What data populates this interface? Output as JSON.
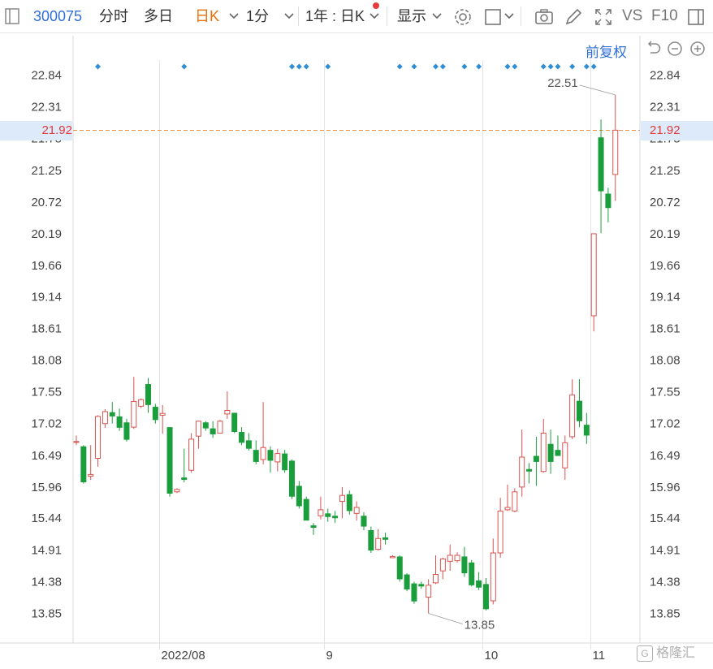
{
  "toolbar": {
    "code": "300075",
    "tab_fenshi": "分时",
    "tab_duori": "多日",
    "tab_rik": "日K",
    "tab_1fen": "1分",
    "range": "1年 : 日K",
    "display": "显示",
    "vs": "VS",
    "f10": "F10",
    "accent_color": "#e8710a",
    "code_color": "#2f6fd6"
  },
  "subbar": {
    "adjust_label": "前复权"
  },
  "current_price": {
    "left": "21.92",
    "right": "21.92",
    "value": 21.92
  },
  "annotations": {
    "high_label": "22.51",
    "low_label": "13.85"
  },
  "watermark": {
    "text": "格隆汇"
  },
  "chart_data": {
    "type": "candlestick",
    "y_ticks": [
      "22.84",
      "22.31",
      "21.78",
      "21.25",
      "20.72",
      "20.19",
      "19.66",
      "19.14",
      "18.61",
      "18.08",
      "17.55",
      "17.02",
      "16.49",
      "15.96",
      "15.44",
      "14.91",
      "14.38",
      "13.85"
    ],
    "ylim": [
      13.85,
      22.84
    ],
    "x_labels": [
      {
        "label": "2022/08",
        "index": 12
      },
      {
        "label": "9",
        "index": 35
      },
      {
        "label": "10",
        "index": 57
      },
      {
        "label": "11",
        "index": 72
      }
    ],
    "up_color": "#d9534f",
    "down_color": "#1a9e3c",
    "marker_color": "#2f8fd6",
    "markers": [
      3,
      15,
      30,
      31,
      32,
      35,
      45,
      47,
      50,
      51,
      54,
      56,
      60,
      61,
      65,
      66,
      67,
      69,
      71,
      72
    ],
    "candles": [
      {
        "o": 16.72,
        "h": 16.82,
        "l": 16.66,
        "c": 16.72
      },
      {
        "o": 16.64,
        "h": 16.66,
        "l": 16.02,
        "c": 16.04
      },
      {
        "o": 16.14,
        "h": 16.66,
        "l": 16.08,
        "c": 16.17
      },
      {
        "o": 16.44,
        "h": 17.16,
        "l": 16.3,
        "c": 17.14
      },
      {
        "o": 17.02,
        "h": 17.26,
        "l": 16.95,
        "c": 17.22
      },
      {
        "o": 17.21,
        "h": 17.38,
        "l": 17.02,
        "c": 17.14
      },
      {
        "o": 17.14,
        "h": 17.27,
        "l": 16.9,
        "c": 16.95
      },
      {
        "o": 17.04,
        "h": 17.1,
        "l": 16.72,
        "c": 16.75
      },
      {
        "o": 16.96,
        "h": 17.8,
        "l": 16.93,
        "c": 17.39
      },
      {
        "o": 17.31,
        "h": 17.44,
        "l": 17.28,
        "c": 17.42
      },
      {
        "o": 17.68,
        "h": 17.78,
        "l": 17.2,
        "c": 17.33
      },
      {
        "o": 17.3,
        "h": 17.35,
        "l": 17.02,
        "c": 17.08
      },
      {
        "o": 17.16,
        "h": 17.33,
        "l": 16.85,
        "c": 17.19
      },
      {
        "o": 16.96,
        "h": 16.96,
        "l": 15.8,
        "c": 15.85
      },
      {
        "o": 15.88,
        "h": 15.94,
        "l": 15.86,
        "c": 15.92
      },
      {
        "o": 16.12,
        "h": 16.6,
        "l": 16.04,
        "c": 16.08
      },
      {
        "o": 16.24,
        "h": 16.86,
        "l": 16.2,
        "c": 16.76
      },
      {
        "o": 16.81,
        "h": 17.06,
        "l": 16.6,
        "c": 17.06
      },
      {
        "o": 17.04,
        "h": 17.06,
        "l": 16.9,
        "c": 16.94
      },
      {
        "o": 16.94,
        "h": 17.06,
        "l": 16.78,
        "c": 16.84
      },
      {
        "o": 16.86,
        "h": 17.08,
        "l": 16.86,
        "c": 17.06
      },
      {
        "o": 17.18,
        "h": 17.56,
        "l": 17.1,
        "c": 17.24
      },
      {
        "o": 17.2,
        "h": 17.2,
        "l": 16.86,
        "c": 16.88
      },
      {
        "o": 16.88,
        "h": 16.96,
        "l": 16.66,
        "c": 16.7
      },
      {
        "o": 16.74,
        "h": 16.86,
        "l": 16.57,
        "c": 16.6
      },
      {
        "o": 16.58,
        "h": 16.74,
        "l": 16.34,
        "c": 16.38
      },
      {
        "o": 16.42,
        "h": 17.38,
        "l": 16.34,
        "c": 16.62
      },
      {
        "o": 16.58,
        "h": 16.64,
        "l": 16.2,
        "c": 16.4
      },
      {
        "o": 16.38,
        "h": 16.6,
        "l": 16.22,
        "c": 16.52
      },
      {
        "o": 16.52,
        "h": 16.58,
        "l": 16.2,
        "c": 16.24
      },
      {
        "o": 16.4,
        "h": 16.42,
        "l": 15.76,
        "c": 15.8
      },
      {
        "o": 15.98,
        "h": 16.06,
        "l": 15.6,
        "c": 15.64
      },
      {
        "o": 15.76,
        "h": 15.8,
        "l": 15.44,
        "c": 15.4
      },
      {
        "o": 15.32,
        "h": 15.36,
        "l": 15.16,
        "c": 15.28
      },
      {
        "o": 15.48,
        "h": 15.8,
        "l": 15.42,
        "c": 15.58
      },
      {
        "o": 15.52,
        "h": 15.6,
        "l": 15.38,
        "c": 15.46
      },
      {
        "o": 15.48,
        "h": 15.56,
        "l": 15.36,
        "c": 15.44
      },
      {
        "o": 15.72,
        "h": 15.96,
        "l": 15.44,
        "c": 15.82
      },
      {
        "o": 15.84,
        "h": 15.9,
        "l": 15.5,
        "c": 15.56
      },
      {
        "o": 15.52,
        "h": 15.72,
        "l": 15.4,
        "c": 15.62
      },
      {
        "o": 15.48,
        "h": 15.54,
        "l": 15.24,
        "c": 15.3
      },
      {
        "o": 15.24,
        "h": 15.3,
        "l": 14.86,
        "c": 14.9
      },
      {
        "o": 14.92,
        "h": 15.26,
        "l": 14.9,
        "c": 15.1
      },
      {
        "o": 15.12,
        "h": 15.2,
        "l": 15.0,
        "c": 15.08
      },
      {
        "o": 14.78,
        "h": 14.82,
        "l": 14.78,
        "c": 14.8
      },
      {
        "o": 14.8,
        "h": 14.82,
        "l": 14.38,
        "c": 14.42
      },
      {
        "o": 14.5,
        "h": 14.52,
        "l": 14.22,
        "c": 14.25
      },
      {
        "o": 14.35,
        "h": 14.38,
        "l": 14.01,
        "c": 14.05
      },
      {
        "o": 14.34,
        "h": 14.38,
        "l": 14.26,
        "c": 14.3
      },
      {
        "o": 14.12,
        "h": 14.42,
        "l": 13.85,
        "c": 14.32
      },
      {
        "o": 14.36,
        "h": 14.82,
        "l": 14.34,
        "c": 14.5
      },
      {
        "o": 14.56,
        "h": 14.78,
        "l": 14.42,
        "c": 14.76
      },
      {
        "o": 14.72,
        "h": 15.0,
        "l": 14.56,
        "c": 14.82
      },
      {
        "o": 14.73,
        "h": 14.87,
        "l": 14.7,
        "c": 14.82
      },
      {
        "o": 14.8,
        "h": 14.96,
        "l": 14.46,
        "c": 14.52
      },
      {
        "o": 14.7,
        "h": 14.74,
        "l": 14.3,
        "c": 14.32
      },
      {
        "o": 14.4,
        "h": 14.54,
        "l": 14.24,
        "c": 14.28
      },
      {
        "o": 14.34,
        "h": 14.44,
        "l": 13.9,
        "c": 13.92
      },
      {
        "o": 14.06,
        "h": 15.1,
        "l": 14.0,
        "c": 14.86
      },
      {
        "o": 14.86,
        "h": 15.78,
        "l": 14.78,
        "c": 15.56
      },
      {
        "o": 15.58,
        "h": 16.0,
        "l": 15.56,
        "c": 15.62
      },
      {
        "o": 15.56,
        "h": 15.94,
        "l": 15.54,
        "c": 15.88
      },
      {
        "o": 15.96,
        "h": 16.92,
        "l": 15.8,
        "c": 16.46
      },
      {
        "o": 16.26,
        "h": 16.36,
        "l": 16.02,
        "c": 16.22
      },
      {
        "o": 16.48,
        "h": 16.8,
        "l": 15.98,
        "c": 16.38
      },
      {
        "o": 16.22,
        "h": 17.1,
        "l": 16.2,
        "c": 16.86
      },
      {
        "o": 16.68,
        "h": 16.92,
        "l": 16.18,
        "c": 16.38
      },
      {
        "o": 16.58,
        "h": 16.82,
        "l": 16.54,
        "c": 16.48
      },
      {
        "o": 16.28,
        "h": 16.82,
        "l": 16.08,
        "c": 16.7
      },
      {
        "o": 16.8,
        "h": 17.76,
        "l": 16.76,
        "c": 17.5
      },
      {
        "o": 17.4,
        "h": 17.76,
        "l": 16.96,
        "c": 17.06
      },
      {
        "o": 17.0,
        "h": 17.2,
        "l": 16.68,
        "c": 16.82
      },
      {
        "o": 18.82,
        "h": 20.19,
        "l": 18.56,
        "c": 20.19
      },
      {
        "o": 21.8,
        "h": 22.1,
        "l": 20.2,
        "c": 20.9
      },
      {
        "o": 20.86,
        "h": 20.96,
        "l": 20.38,
        "c": 20.62
      },
      {
        "o": 21.18,
        "h": 22.51,
        "l": 20.74,
        "c": 21.92
      }
    ]
  }
}
